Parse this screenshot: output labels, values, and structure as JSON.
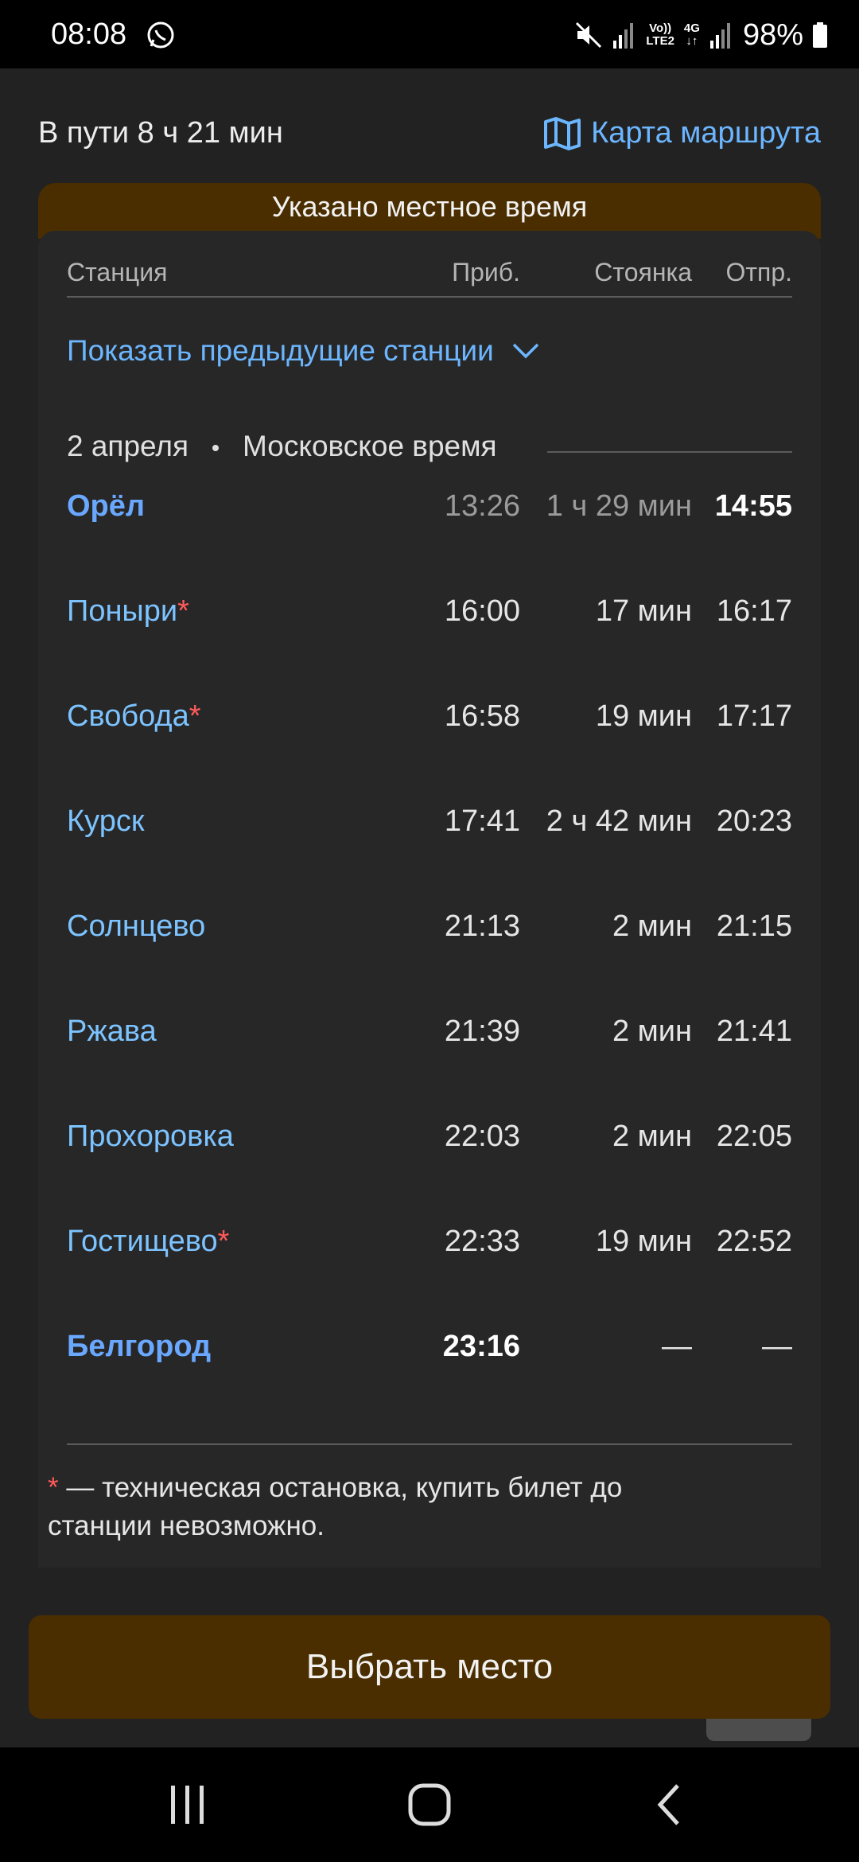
{
  "status_bar": {
    "time": "08:08",
    "network_label_top": "Vo))",
    "network_label_bottom": "LTE2",
    "network_4g": "4G",
    "battery": "98%"
  },
  "header": {
    "trip_time": "В пути 8 ч 21 мин",
    "route_map": "Карта маршрута"
  },
  "banner": {
    "text": "Указано местное время"
  },
  "table": {
    "headers": {
      "station": "Станция",
      "arrival": "Приб.",
      "stop": "Стоянка",
      "departure": "Отпр."
    },
    "show_previous": "Показать предыдущие станции",
    "date": "2 апреля",
    "timezone": "Московское время",
    "rows": [
      {
        "station": "Орёл",
        "star": "",
        "arrival": "13:26",
        "stop": "1 ч 29 мин",
        "departure": "14:55"
      },
      {
        "station": "Поныри",
        "star": "*",
        "arrival": "16:00",
        "stop": "17 мин",
        "departure": "16:17"
      },
      {
        "station": "Свобода",
        "star": "*",
        "arrival": "16:58",
        "stop": "19 мин",
        "departure": "17:17"
      },
      {
        "station": "Курск",
        "star": "",
        "arrival": "17:41",
        "stop": "2 ч 42 мин",
        "departure": "20:23"
      },
      {
        "station": "Солнцево",
        "star": "",
        "arrival": "21:13",
        "stop": "2 мин",
        "departure": "21:15"
      },
      {
        "station": "Ржава",
        "star": "",
        "arrival": "21:39",
        "stop": "2 мин",
        "departure": "21:41"
      },
      {
        "station": "Прохоровка",
        "star": "",
        "arrival": "22:03",
        "stop": "2 мин",
        "departure": "22:05"
      },
      {
        "station": "Гостищево",
        "star": "*",
        "arrival": "22:33",
        "stop": "19 мин",
        "departure": "22:52"
      },
      {
        "station": "Белгород",
        "star": "",
        "arrival": "23:16",
        "stop": "—",
        "departure": "—"
      }
    ]
  },
  "footnote": {
    "star": "*",
    "text": " — техническая остановка, купить билет до станции невозможно."
  },
  "actions": {
    "choose_seat": "Выбрать место"
  },
  "colors": {
    "background": "#222222",
    "accent_link": "#6cb6ff",
    "banner_brown": "#4a2e00",
    "star_red": "#ff5a5a"
  },
  "icons": {
    "messenger": "whatsapp-icon",
    "map": "map-icon",
    "chevron": "chevron-down-icon",
    "scroll_top": "arrow-up-icon",
    "nav_recent": "recent-apps-icon",
    "nav_home": "home-icon",
    "nav_back": "back-icon"
  }
}
